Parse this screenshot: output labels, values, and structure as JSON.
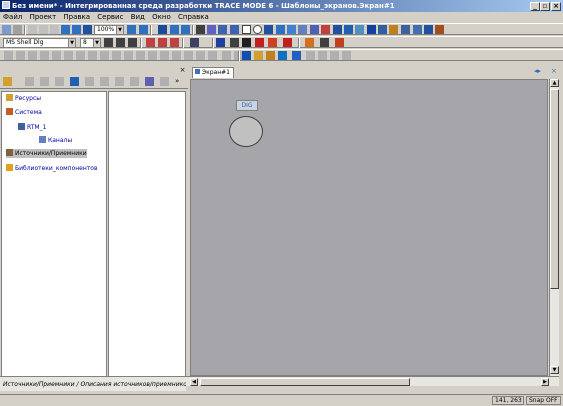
{
  "window": {
    "title": "Без имени* - Интегрированная среда разработки TRACE MODE 6 - Шаблоны_экранов.Экран#1"
  },
  "menu": [
    "Файл",
    "Проект",
    "Правка",
    "Сервис",
    "Вид",
    "Окно",
    "Справка"
  ],
  "toolbar": {
    "zoom": "100%",
    "font_name": "MS Shell Dlg",
    "font_size": "8"
  },
  "tree": {
    "items": [
      {
        "label": "Ресурсы",
        "icon": "folder-icon"
      },
      {
        "label": "Система",
        "icon": "network-icon"
      },
      {
        "label": "RTM_1",
        "icon": "computer-icon"
      },
      {
        "label": "Каналы",
        "icon": "channels-icon"
      },
      {
        "label": "Источники/Приемники",
        "icon": "io-icon"
      },
      {
        "label": "Библиотеки_компонентов",
        "icon": "library-icon"
      }
    ]
  },
  "editor": {
    "tab_label": "Экран#1",
    "element_label": "DIG"
  },
  "bottom_tab": "Источники/Приемники / Описания источников/приемников раз",
  "status": {
    "coords": "141, 263",
    "snap": "Snap OFF"
  },
  "colors": {
    "title_start": "#0a246a",
    "title_end": "#a6caf0",
    "canvas": "#a6a6aa"
  }
}
